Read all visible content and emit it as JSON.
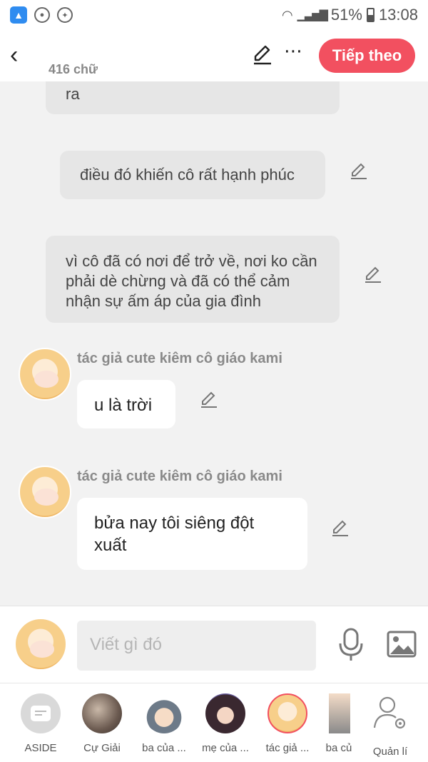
{
  "status_bar": {
    "battery": "51%",
    "time": "13:08",
    "app_icon": "rocket-icon"
  },
  "header": {
    "word_count": "416 chữ",
    "next_label": "Tiếp theo"
  },
  "messages": [
    {
      "type": "narration",
      "text": "ra"
    },
    {
      "type": "narration",
      "text": "điều đó khiến cô rất hạnh phúc"
    },
    {
      "type": "narration",
      "text": "vì cô đã có nơi để trở về, nơi ko cần phải dè chừng và đã có thể cảm nhận sự ấm áp của gia đình"
    },
    {
      "type": "dialogue",
      "speaker": "tác giả cute kiêm cô giáo kami",
      "text": "u là trời"
    },
    {
      "type": "dialogue",
      "speaker": "tác giả cute kiêm cô giáo kami",
      "text": "bửa nay tôi siêng đột xuất"
    }
  ],
  "composer": {
    "placeholder": "Viết gì đó"
  },
  "characters": [
    {
      "label": "ASIDE"
    },
    {
      "label": "Cự Giải"
    },
    {
      "label": "ba của ..."
    },
    {
      "label": "mẹ của ..."
    },
    {
      "label": "tác giả ..."
    },
    {
      "label": "ba củ"
    },
    {
      "label": "Quản lí"
    }
  ],
  "colors": {
    "accent": "#f25060",
    "background": "#f2f2f2",
    "narration_bubble": "#e6e6e6",
    "dialogue_bubble": "#ffffff"
  }
}
